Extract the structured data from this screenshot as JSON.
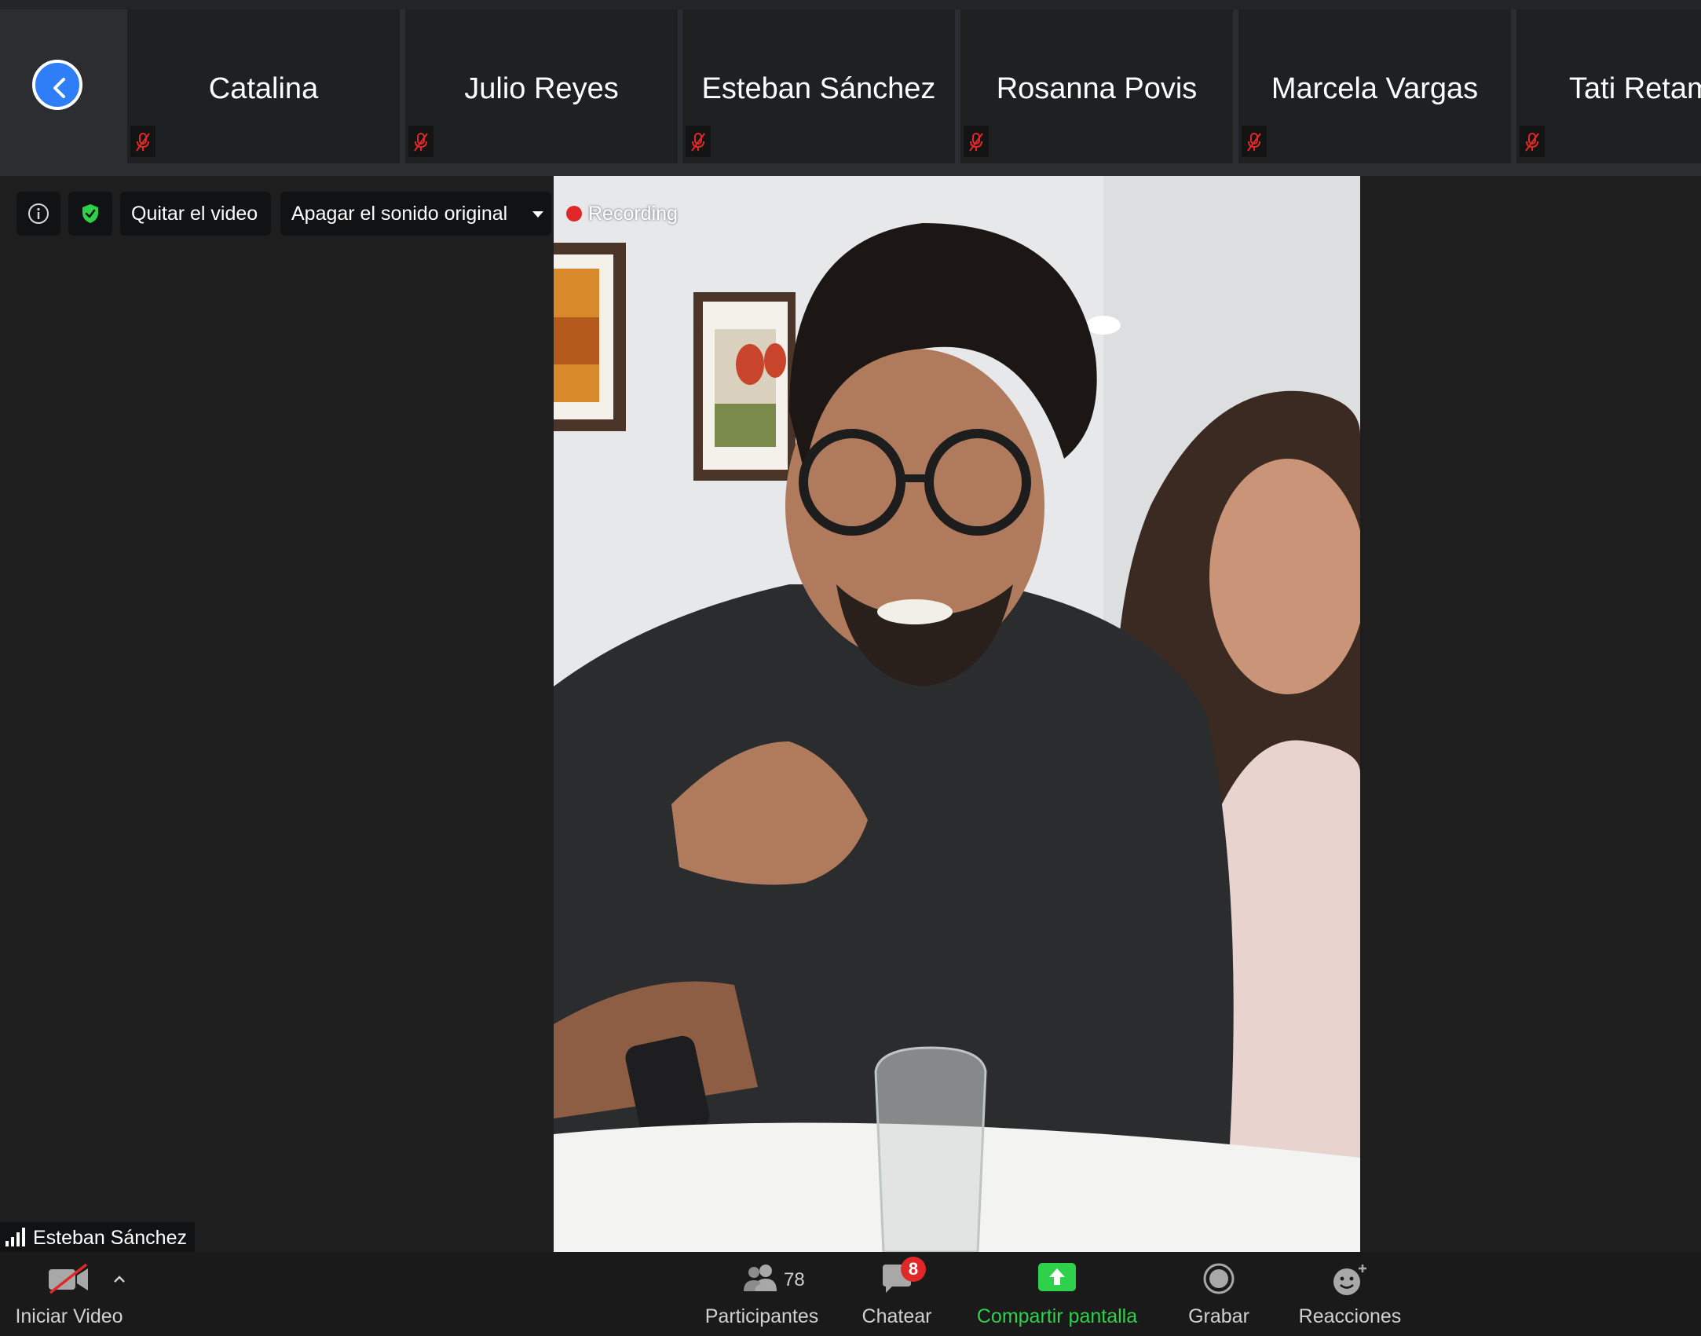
{
  "participants_strip": {
    "participants": [
      {
        "name": "Catalina",
        "muted": true
      },
      {
        "name": "Julio Reyes",
        "muted": true
      },
      {
        "name": "Esteban Sánchez",
        "muted": true
      },
      {
        "name": "Rosanna Povis",
        "muted": true
      },
      {
        "name": "Marcela Vargas",
        "muted": true
      },
      {
        "name": "Tati Retam",
        "muted": true
      }
    ]
  },
  "meeting_bar": {
    "remove_video_label": "Quitar el video",
    "mute_original_label": "Apagar el sonido original"
  },
  "video": {
    "recording_label": "Recording",
    "active_speaker": "Esteban Sánchez"
  },
  "toolbar": {
    "start_video_label": "Iniciar Video",
    "participants_label": "Participantes",
    "participants_count": "78",
    "chat_label": "Chatear",
    "chat_badge": "8",
    "share_label": "Compartir pantalla",
    "record_label": "Grabar",
    "reactions_label": "Reacciones"
  },
  "colors": {
    "accent_blue": "#2d7ef7",
    "share_green": "#2fd04a",
    "badge_red": "#e02828",
    "muted_red": "#e02828"
  }
}
